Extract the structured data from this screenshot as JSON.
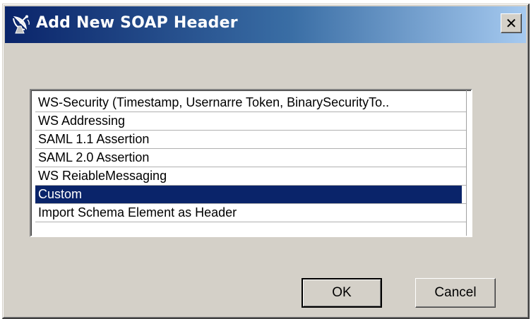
{
  "window": {
    "title": "Add New SOAP Header",
    "title_icon": "satellite-dish-icon",
    "close_glyph": "✕",
    "titlebar_color_start": "#0a246a",
    "titlebar_color_end": "#a6caf0",
    "face_color": "#d4d0c8"
  },
  "header_list": {
    "items": [
      {
        "label": "WS-Security (Timestamp, Usernarre Token, BinarySecurityTo..",
        "selected": false
      },
      {
        "label": "WS Addressing",
        "selected": false
      },
      {
        "label": "SAML 1.1 Assertion",
        "selected": false
      },
      {
        "label": "SAML 2.0 Assertion",
        "selected": false
      },
      {
        "label": "WS ReiableMessaging",
        "selected": false
      },
      {
        "label": "Custom",
        "selected": true
      },
      {
        "label": "Import Schema Element as Header",
        "selected": false
      }
    ],
    "selection_color": "#0a246a"
  },
  "buttons": {
    "ok_label": "OK",
    "cancel_label": "Cancel"
  }
}
